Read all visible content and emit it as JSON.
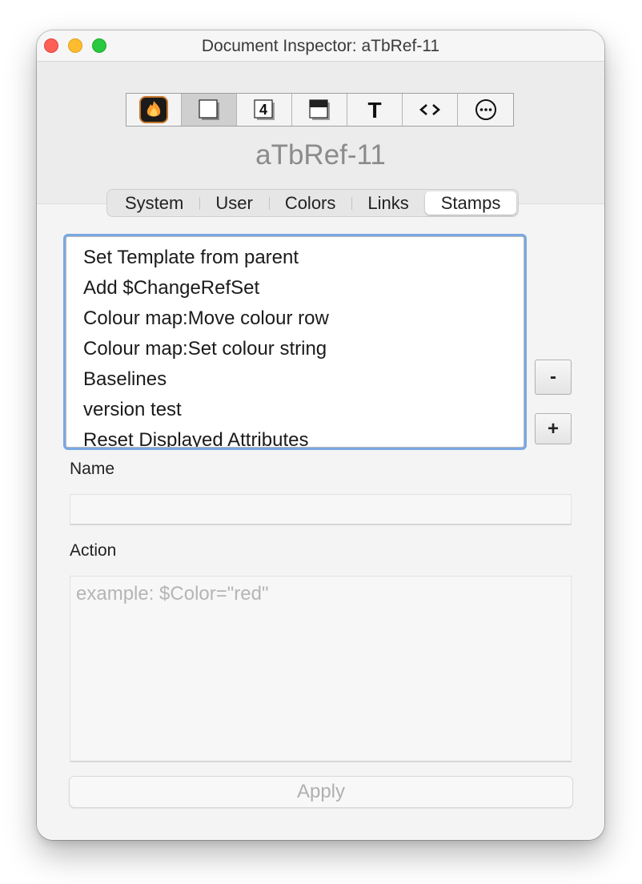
{
  "window": {
    "title": "Document Inspector: aTbRef-11"
  },
  "toolbar": {
    "buttons": [
      {
        "icon": "flame-app-icon",
        "active": false
      },
      {
        "icon": "document-page-icon",
        "active": true
      },
      {
        "icon": "number-4-icon",
        "label": "4",
        "active": false
      },
      {
        "icon": "window-shade-icon",
        "active": false
      },
      {
        "icon": "text-T-icon",
        "label": "T",
        "active": false
      },
      {
        "icon": "code-brackets-icon",
        "label": "<>",
        "active": false
      },
      {
        "icon": "more-ellipsis-icon",
        "label": "⋯",
        "active": false
      }
    ]
  },
  "document_name": "aTbRef-11",
  "tabs": [
    "System",
    "User",
    "Colors",
    "Links",
    "Stamps"
  ],
  "selected_tab": "Stamps",
  "stamps": [
    "Set Template from parent",
    "Add $ChangeRefSet",
    "Colour map:Move colour row",
    "Colour map:Set colour string",
    "Baselines",
    "version test",
    "Reset Displayed Attributes"
  ],
  "buttons": {
    "remove": "-",
    "add": "+",
    "apply": "Apply"
  },
  "form": {
    "name_label": "Name",
    "name_value": "",
    "action_label": "Action",
    "action_placeholder": "example: $Color=\"red\""
  }
}
